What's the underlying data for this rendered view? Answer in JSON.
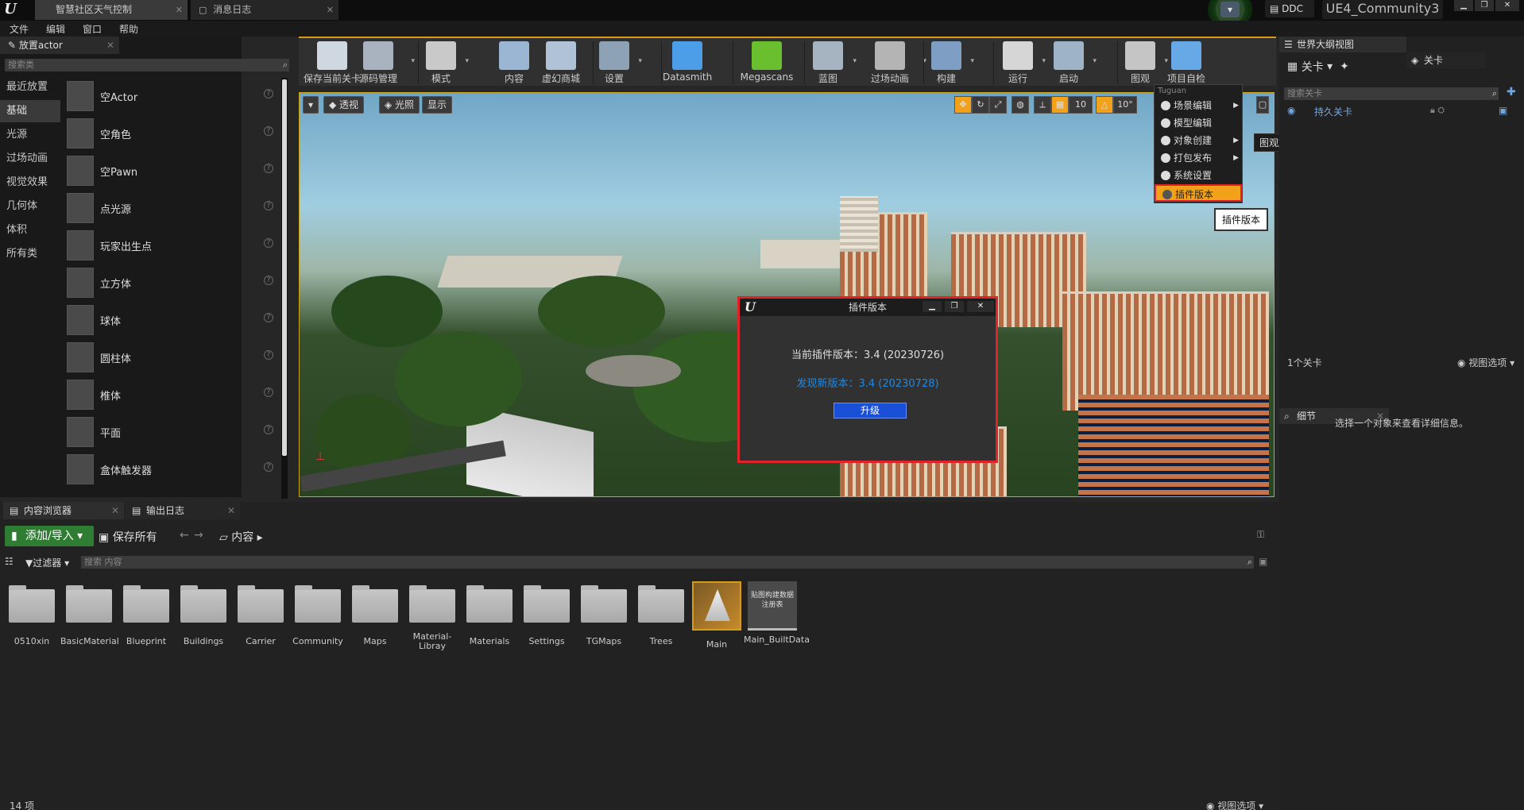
{
  "app": {
    "tabs": [
      "智慧社区天气控制",
      "消息日志"
    ],
    "ddc": "DDC",
    "project": "UE4_Community3"
  },
  "menu": [
    "文件",
    "编辑",
    "窗口",
    "帮助"
  ],
  "place": {
    "tab": "放置actor",
    "search_placeholder": "搜索类",
    "categories": [
      "最近放置",
      "基础",
      "光源",
      "过场动画",
      "视觉效果",
      "几何体",
      "体积",
      "所有类"
    ],
    "items": [
      "空Actor",
      "空角色",
      "空Pawn",
      "点光源",
      "玩家出生点",
      "立方体",
      "球体",
      "圆柱体",
      "椎体",
      "平面",
      "盒体触发器"
    ]
  },
  "toolbar": [
    {
      "label": "保存当前关卡",
      "color": "#cfd8e0"
    },
    {
      "label": "源码管理",
      "color": "#a9b3bf"
    },
    {
      "label": "模式",
      "color": "#c9c9c9"
    },
    {
      "label": "内容",
      "color": "#9bb6d3"
    },
    {
      "label": "虚幻商城",
      "color": "#b0c3d6"
    },
    {
      "label": "设置",
      "color": "#8ea2b6"
    },
    {
      "label": "Datasmith",
      "color": "#4d9ee8"
    },
    {
      "label": "Megascans",
      "color": "#6abf2f"
    },
    {
      "label": "蓝图",
      "color": "#a6b4c2"
    },
    {
      "label": "过场动画",
      "color": "#b4b4b4"
    },
    {
      "label": "构建",
      "color": "#7f9ec4"
    },
    {
      "label": "运行",
      "color": "#d6d6d6"
    },
    {
      "label": "启动",
      "color": "#9fb3c7"
    },
    {
      "label": "图观",
      "color": "#c5c5c5"
    },
    {
      "label": "项目自检",
      "color": "#66a9e6"
    }
  ],
  "viewport": {
    "perspective": "透视",
    "lighting": "光照",
    "show": "显示",
    "grid": "10",
    "angle": "10°"
  },
  "dropdown": {
    "header": "Tuguan",
    "items": [
      "场景编辑",
      "模型编辑",
      "对象创建",
      "打包发布",
      "系统设置",
      "插件版本"
    ],
    "tip_actor": "图观放置actor",
    "tip_version": "插件版本"
  },
  "modal": {
    "title": "插件版本",
    "current": "当前插件版本：3.4 (20230726)",
    "new": "发现新版本：3.4 (20230728)",
    "upgrade": "升级"
  },
  "outliner": {
    "tab1": "世界大纲视图",
    "tab2": "关卡",
    "levels": "关卡",
    "search_placeholder": "搜索关卡",
    "level_item": "持久关卡",
    "count": "1个关卡",
    "view_options": "视图选项"
  },
  "details": {
    "tab": "细节",
    "empty": "选择一个对象来查看详细信息。"
  },
  "content": {
    "tab1": "内容浏览器",
    "tab2": "输出日志",
    "add": "添加/导入",
    "save_all": "保存所有",
    "path": "内容",
    "filters": "过滤器",
    "search_placeholder": "搜索 内容",
    "folders": [
      "0510xin",
      "BasicMaterial",
      "Blueprint",
      "Buildings",
      "Carrier",
      "Community",
      "Maps",
      "Material-Libray",
      "Materials",
      "Settings",
      "TGMaps",
      "Trees"
    ],
    "assets": [
      "Main",
      "Main_BuiltData"
    ],
    "builtdata_thumb": "贴图构建数据注册表",
    "count": "14 项",
    "view_options": "视图选项"
  }
}
